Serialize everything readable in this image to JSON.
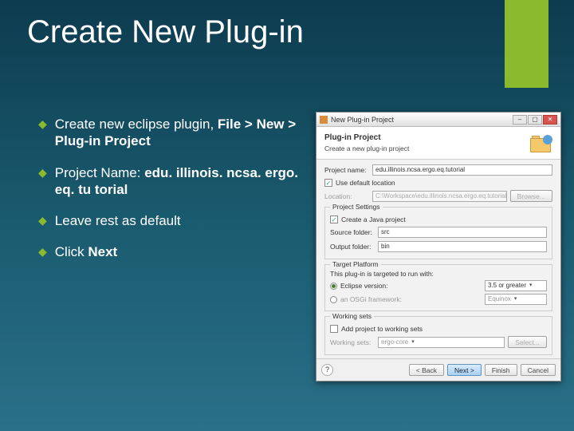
{
  "slide": {
    "title": "Create New Plug-in",
    "bullets": [
      {
        "pre": "Create new eclipse plugin, ",
        "bold": "File > New > Plug-in Project",
        "post": ""
      },
      {
        "pre": "Project Name: ",
        "bold": "edu. illinois. ncsa. ergo. eq. tu torial",
        "post": ""
      },
      {
        "pre": "Leave rest as default",
        "bold": "",
        "post": ""
      },
      {
        "pre": "Click ",
        "bold": "Next",
        "post": ""
      }
    ]
  },
  "dialog": {
    "window_title": "New Plug-in Project",
    "header_title": "Plug-in Project",
    "header_sub": "Create a new plug-in project",
    "labels": {
      "project_name": "Project name:",
      "use_default": "Use default location",
      "location": "Location:",
      "browse": "Browse...",
      "project_settings": "Project Settings",
      "create_java": "Create a Java project",
      "source_folder": "Source folder:",
      "output_folder": "Output folder:",
      "target_platform": "Target Platform",
      "target_hint": "This plug-in is targeted to run with:",
      "eclipse_ver": "Eclipse version:",
      "osgi": "an OSGi framework:",
      "working_sets": "Working sets",
      "add_to_ws": "Add project to working sets",
      "working_sets_lbl": "Working sets:",
      "select": "Select..."
    },
    "values": {
      "project_name": "edu.illinois.ncsa.ergo.eq.tutorial",
      "location": "C:\\Workspace\\edu.illinois.ncsa.ergo.eq.tutorial",
      "source_folder": "src",
      "output_folder": "bin",
      "eclipse_combo": "3.5 or greater",
      "osgi_combo": "Equinox",
      "ws_combo": "ergo-core"
    },
    "buttons": {
      "back": "< Back",
      "next": "Next >",
      "finish": "Finish",
      "cancel": "Cancel"
    }
  }
}
